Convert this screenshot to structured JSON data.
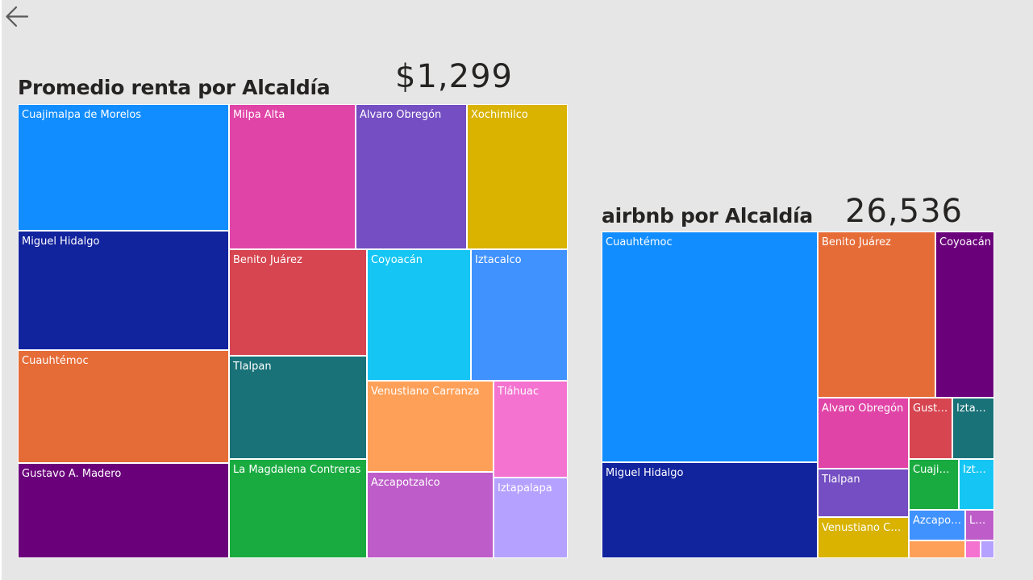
{
  "nav": {
    "back_icon": "arrow-left-icon"
  },
  "cards": {
    "renta": {
      "title": "Promedio renta por Alcaldía",
      "kpi": "$1,299"
    },
    "airbnb": {
      "title": "airbnb por Alcaldía",
      "kpi": "26,536"
    }
  },
  "chart_data": [
    {
      "type": "treemap",
      "title": "Promedio renta por Alcaldía",
      "items": [
        {
          "label": "Cuajimalpa de Morelos",
          "color": "#118dff"
        },
        {
          "label": "Miguel Hidalgo",
          "color": "#12239e"
        },
        {
          "label": "Cuauhtémoc",
          "color": "#e66c37"
        },
        {
          "label": "Gustavo A. Madero",
          "color": "#6b007b"
        },
        {
          "label": "Milpa Alta",
          "color": "#e044a7"
        },
        {
          "label": "Álvaro Obregón",
          "color": "#744ec2"
        },
        {
          "label": "Xochimilco",
          "color": "#d9b300"
        },
        {
          "label": "Benito Juárez",
          "color": "#d64550"
        },
        {
          "label": "Tlalpan",
          "color": "#197278"
        },
        {
          "label": "La Magdalena Contreras",
          "color": "#1aab40"
        },
        {
          "label": "Coyoacán",
          "color": "#15c6f4"
        },
        {
          "label": "Iztacalco",
          "color": "#4092ff"
        },
        {
          "label": "Venustiano Carranza",
          "color": "#ffa058"
        },
        {
          "label": "Tláhuac",
          "color": "#f472d0"
        },
        {
          "label": "Azcapotzalco",
          "color": "#be5dc9"
        },
        {
          "label": "Iztapalapa",
          "color": "#b5a1ff"
        }
      ]
    },
    {
      "type": "treemap",
      "title": "airbnb por Alcaldía",
      "items": [
        {
          "label": "Cuauhtémoc",
          "color": "#118dff"
        },
        {
          "label": "Miguel Hidalgo",
          "color": "#12239e"
        },
        {
          "label": "Benito Juárez",
          "color": "#e66c37"
        },
        {
          "label": "Coyoacán",
          "color": "#6b007b"
        },
        {
          "label": "Álvaro Obregón",
          "color": "#e044a7"
        },
        {
          "label": "Tlalpan",
          "color": "#744ec2"
        },
        {
          "label": "Venustiano Carranza",
          "color": "#d9b300"
        },
        {
          "label": "Gustavo A. Madero",
          "color": "#d64550"
        },
        {
          "label": "Iztacalco",
          "color": "#197278"
        },
        {
          "label": "Cuajimalpa de Morelos",
          "color": "#1aab40"
        },
        {
          "label": "Iztapalapa",
          "color": "#15c6f4"
        },
        {
          "label": "Azcapotzalco",
          "color": "#4092ff"
        },
        {
          "label": "La Magdalena Contreras",
          "color": "#be5dc9"
        },
        {
          "label": "",
          "color": "#ffa058"
        },
        {
          "label": "",
          "color": "#f472d0"
        },
        {
          "label": "",
          "color": "#b5a1ff"
        }
      ]
    }
  ]
}
